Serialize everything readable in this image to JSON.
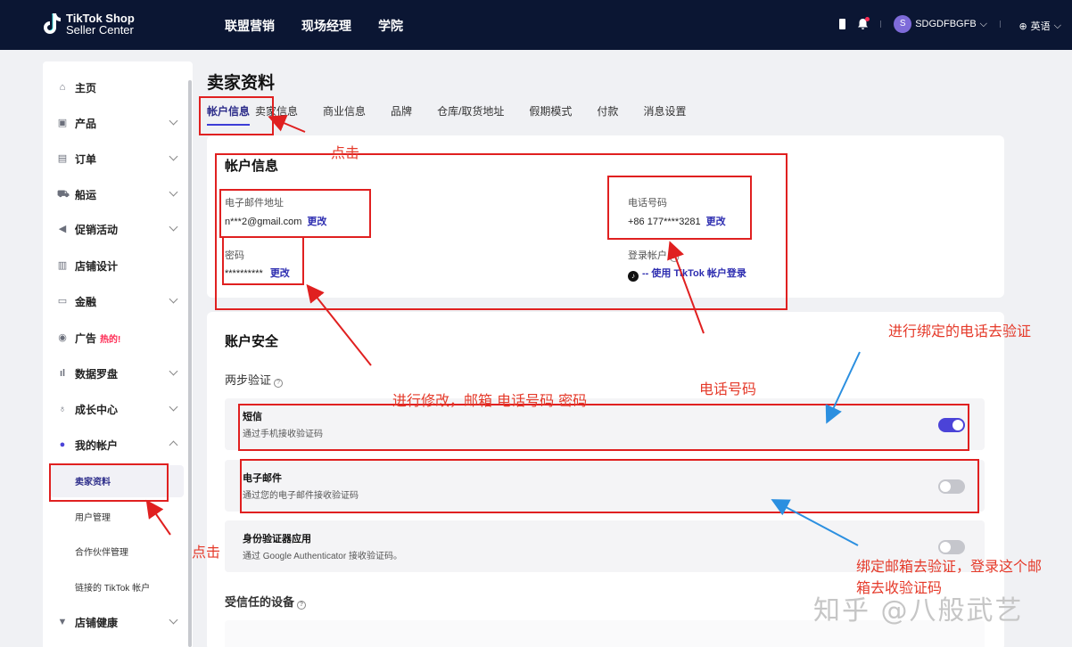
{
  "header": {
    "logo_line1": "TikTok Shop",
    "logo_line2": "Seller Center",
    "nav": [
      "联盟营销",
      "现场经理",
      "学院"
    ],
    "user_initial": "S",
    "user_name": "SDGDFBGFB",
    "language": "英语"
  },
  "sidebar": {
    "items": [
      {
        "label": "主页",
        "icon": "home-icon"
      },
      {
        "label": "产品",
        "icon": "box-icon"
      },
      {
        "label": "订单",
        "icon": "order-icon"
      },
      {
        "label": "船运",
        "icon": "truck-icon"
      },
      {
        "label": "促销活动",
        "icon": "megaphone-icon"
      },
      {
        "label": "店铺设计",
        "icon": "store-icon"
      },
      {
        "label": "金融",
        "icon": "card-icon"
      },
      {
        "label": "广告",
        "icon": "ad-icon",
        "badge": "热的!"
      },
      {
        "label": "数据罗盘",
        "icon": "chart-icon"
      },
      {
        "label": "成长中心",
        "icon": "medal-icon"
      },
      {
        "label": "我的帐户",
        "icon": "user-icon"
      },
      {
        "label": "店铺健康",
        "icon": "health-icon"
      }
    ],
    "sub_items": [
      "卖家资料",
      "用户管理",
      "合作伙伴管理",
      "链接的 TikTok 帐户"
    ]
  },
  "page": {
    "title": "卖家资料",
    "tabs": [
      "帐户信息",
      "卖家信息",
      "商业信息",
      "品牌",
      "仓库/取货地址",
      "假期模式",
      "付款",
      "消息设置"
    ]
  },
  "account_info": {
    "heading": "帐户信息",
    "email_label": "电子邮件地址",
    "email_value": "n***2@gmail.com",
    "change": "更改",
    "password_label": "密码",
    "password_value": "**********",
    "phone_label": "电话号码",
    "phone_value": "+86 177****3281",
    "login_label": "登录帐户",
    "login_value": "-- 使用 TikTok 帐户登录"
  },
  "security": {
    "heading": "账户安全",
    "two_step": "两步验证",
    "rows": [
      {
        "title": "短信",
        "desc": "通过手机接收验证码",
        "enabled": true
      },
      {
        "title": "电子邮件",
        "desc": "通过您的电子邮件接收验证码",
        "enabled": false
      },
      {
        "title": "身份验证器应用",
        "desc": "通过 Google Authenticator 接收验证码。",
        "enabled": false
      }
    ],
    "trusted": "受信任的设备"
  },
  "annotations": {
    "click1": "点击",
    "click2": "点击",
    "modify": "进行修改，邮箱 电话号码 密码",
    "phone": "电话号码",
    "verify_phone": "进行绑定的电话去验证",
    "verify_email_1": "绑定邮箱去验证，登录这个邮",
    "verify_email_2": "箱去收验证码",
    "watermark": "知乎 @八般武艺"
  },
  "colors": {
    "topbar": "#0b1633",
    "accent": "#4b43d8",
    "annotation_red": "#e02020",
    "annotation_blue": "#2b8fe0"
  }
}
